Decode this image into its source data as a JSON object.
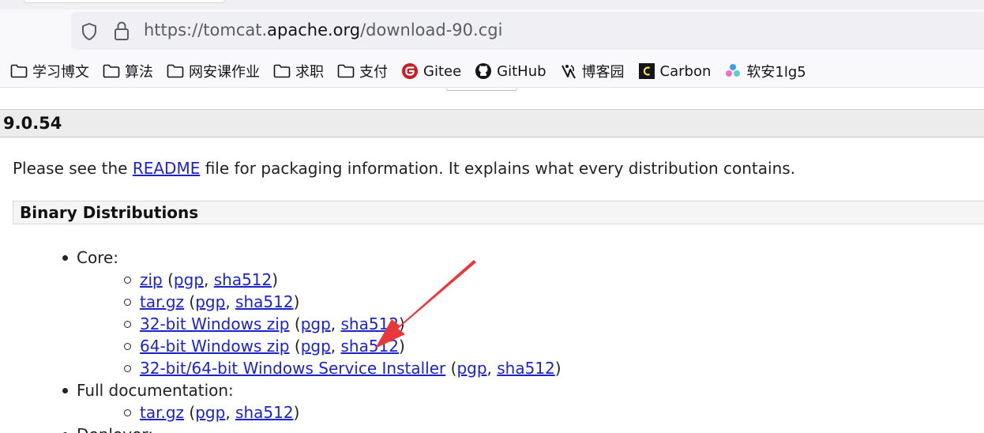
{
  "browser": {
    "url_prefix": "https://tomcat.",
    "url_host": "apache.org",
    "url_path": "/download-90.cgi"
  },
  "bookmarks": [
    {
      "label": "学习博文",
      "icon": "folder-icon"
    },
    {
      "label": "算法",
      "icon": "folder-icon"
    },
    {
      "label": "网安课作业",
      "icon": "folder-icon"
    },
    {
      "label": "求职",
      "icon": "folder-icon"
    },
    {
      "label": "支付",
      "icon": "folder-icon"
    },
    {
      "label": "Gitee",
      "icon": "gitee-icon"
    },
    {
      "label": "GitHub",
      "icon": "github-icon"
    },
    {
      "label": "博客园",
      "icon": "cnblogs-icon"
    },
    {
      "label": "Carbon",
      "icon": "carbon-icon"
    },
    {
      "label": "软安1lg5",
      "icon": "app-icon"
    }
  ],
  "page": {
    "version_heading": "9.0.54",
    "intro_before": "Please see the ",
    "intro_link": "README",
    "intro_after": " file for packaging information. It explains what every distribution contains.",
    "section_heading": "Binary Distributions",
    "groups": [
      {
        "label": "Core:",
        "items": [
          {
            "main": "zip",
            "sig": "pgp",
            "hash": "sha512"
          },
          {
            "main": "tar.gz",
            "sig": "pgp",
            "hash": "sha512"
          },
          {
            "main": "32-bit Windows zip",
            "sig": "pgp",
            "hash": "sha512"
          },
          {
            "main": "64-bit Windows zip",
            "sig": "pgp",
            "hash": "sha512"
          },
          {
            "main": "32-bit/64-bit Windows Service Installer",
            "sig": "pgp",
            "hash": "sha512"
          }
        ]
      },
      {
        "label": "Full documentation:",
        "items": [
          {
            "main": "tar.gz",
            "sig": "pgp",
            "hash": "sha512"
          }
        ]
      },
      {
        "label": "Deployer:",
        "items": []
      }
    ]
  },
  "annotation": {
    "color": "#e8363a"
  }
}
